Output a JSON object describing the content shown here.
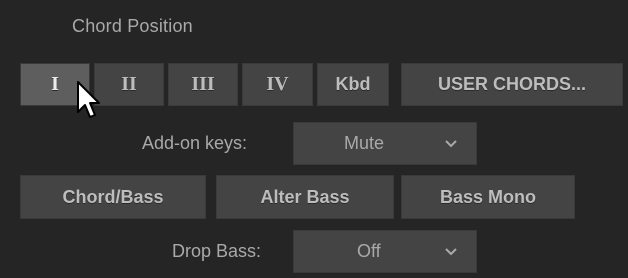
{
  "chord_position": {
    "title": "Chord Position",
    "buttons": [
      "I",
      "II",
      "III",
      "IV",
      "Kbd",
      "USER CHORDS..."
    ],
    "selected": "I"
  },
  "addon_keys": {
    "label": "Add-on keys:",
    "value": "Mute"
  },
  "mode_buttons": [
    "Chord/Bass",
    "Alter Bass",
    "Bass Mono"
  ],
  "drop_bass": {
    "label": "Drop Bass:",
    "value": "Off"
  },
  "colors": {
    "background": "#252525",
    "button": "#444444",
    "button_selected": "#5e5e5e",
    "text": "#a9a9a9"
  },
  "icons": {
    "dropdown": "chevron-down-icon",
    "pointer": "mouse-pointer-icon"
  }
}
